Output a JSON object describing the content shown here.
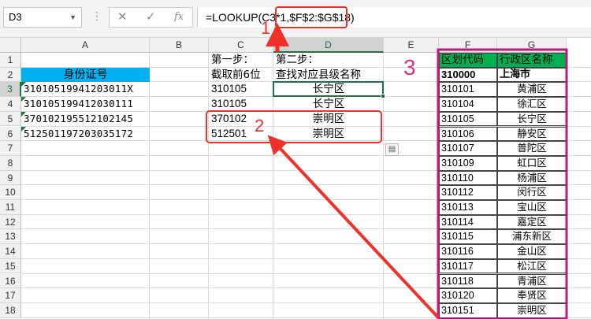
{
  "formula_bar": {
    "name_box": "D3",
    "cancel_glyph": "✕",
    "confirm_glyph": "✓",
    "fx_label": "fx",
    "formula_part1": "=LOOKUP(C3*1,",
    "formula_part2": "$F$2:$G$18)"
  },
  "columns": [
    "A",
    "B",
    "C",
    "D",
    "E",
    "F",
    "G"
  ],
  "rows": [
    "1",
    "2",
    "3",
    "4",
    "5",
    "6",
    "7",
    "8",
    "9",
    "10",
    "11",
    "12",
    "13",
    "14",
    "15",
    "16",
    "17",
    "18"
  ],
  "sheet": {
    "header_id": "身份证号",
    "ids": [
      "31010519941203011X",
      "310105199412030111",
      "370102195512102145",
      "512501197203035172"
    ],
    "step1_title": "第一步：",
    "step1_desc": "截取前6位",
    "step2_title": "第二步：",
    "step2_desc": "查找对应县级名称",
    "prefixes": [
      "310105",
      "310105",
      "370102",
      "512501"
    ],
    "results": [
      "长宁区",
      "长宁区",
      "崇明区",
      "崇明区"
    ]
  },
  "table": {
    "header_code": "区划代码",
    "header_name": "行政区名称",
    "top_code": "310000",
    "top_name": "上海市",
    "rows": [
      {
        "code": "310101",
        "name": "黄浦区"
      },
      {
        "code": "310104",
        "name": "徐汇区"
      },
      {
        "code": "310105",
        "name": "长宁区"
      },
      {
        "code": "310106",
        "name": "静安区"
      },
      {
        "code": "310107",
        "name": "普陀区"
      },
      {
        "code": "310109",
        "name": "虹口区"
      },
      {
        "code": "310110",
        "name": "杨浦区"
      },
      {
        "code": "310112",
        "name": "闵行区"
      },
      {
        "code": "310113",
        "name": "宝山区"
      },
      {
        "code": "310114",
        "name": "嘉定区"
      },
      {
        "code": "310115",
        "name": "浦东新区"
      },
      {
        "code": "310116",
        "name": "金山区"
      },
      {
        "code": "310117",
        "name": "松江区"
      },
      {
        "code": "310118",
        "name": "青浦区"
      },
      {
        "code": "310120",
        "name": "奉贤区"
      },
      {
        "code": "310151",
        "name": "崇明区"
      }
    ]
  },
  "annotations": {
    "label1": "1",
    "label2": "2",
    "label3": "3"
  },
  "colors": {
    "header_blue": "#00b0f0",
    "header_green": "#00b050",
    "annotation_red": "#f0312a",
    "magenta": "#c0187a"
  }
}
